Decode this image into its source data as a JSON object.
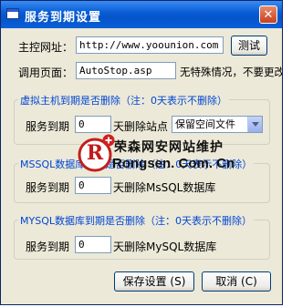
{
  "window": {
    "title": "服务到期设置",
    "close_glyph": "✕"
  },
  "server": {
    "label": "主控网址：",
    "url": "http://www.yoounion.com",
    "test_button": "测试"
  },
  "page": {
    "label": "调用页面：",
    "value": "AutoStop.asp",
    "hint": "无特殊情况，不要更改。"
  },
  "groups": [
    {
      "legend": "虚拟主机到期是否删除（注：0天表示不删除）",
      "label": "服务到期",
      "days": "0",
      "suffix": "天删除站点",
      "select_value": "保留空间文件"
    },
    {
      "legend": "MSSQL数据库到期是否删除（注：0天表示不删除）",
      "label": "服务到期",
      "days": "0",
      "suffix": "天删除MsSQL数据库"
    },
    {
      "legend": "MYSQL数据库到期是否删除（注：0天表示不删除）",
      "label": "服务到期",
      "days": "0",
      "suffix": "天删除MySQL数据库"
    }
  ],
  "footer": {
    "save": "保存设置 (S)",
    "cancel": "取消 (C)"
  },
  "watermark": {
    "logo_letter": "R",
    "cn": "荣森网安网站维护",
    "en": "Rongsen. Com. Cn"
  }
}
